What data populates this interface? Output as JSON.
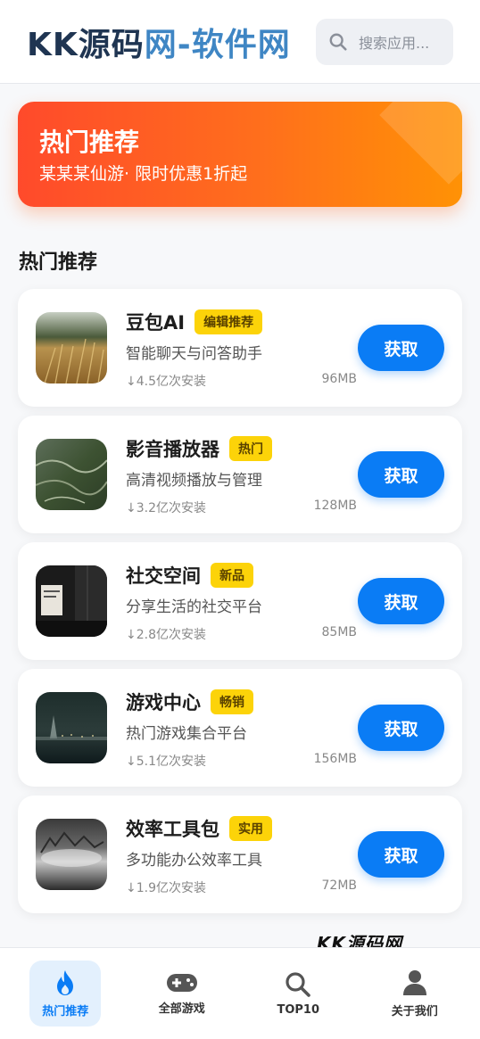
{
  "header": {
    "logo_part1": "KK源码",
    "logo_part2": "网-软件网",
    "search_placeholder": "搜索应用..."
  },
  "banner": {
    "title": "热门推荐",
    "subtitle": "某某某仙游· 限时优惠1折起"
  },
  "section_title": "热门推荐",
  "apps": [
    {
      "name": "豆包AI",
      "tag": "编辑推荐",
      "desc": "智能聊天与问答助手",
      "installs": "↓4.5亿次安装",
      "size": "96MB",
      "button": "获取"
    },
    {
      "name": "影音播放器",
      "tag": "热门",
      "desc": "高清视频播放与管理",
      "installs": "↓3.2亿次安装",
      "size": "128MB",
      "button": "获取"
    },
    {
      "name": "社交空间",
      "tag": "新品",
      "desc": "分享生活的社交平台",
      "installs": "↓2.8亿次安装",
      "size": "85MB",
      "button": "获取"
    },
    {
      "name": "游戏中心",
      "tag": "畅销",
      "desc": "热门游戏集合平台",
      "installs": "↓5.1亿次安装",
      "size": "156MB",
      "button": "获取"
    },
    {
      "name": "效率工具包",
      "tag": "实用",
      "desc": "多功能办公效率工具",
      "installs": "↓1.9亿次安装",
      "size": "72MB",
      "button": "获取"
    }
  ],
  "watermark": "KK源码网",
  "tabbar": [
    {
      "label": "热门推荐",
      "icon": "flame-icon",
      "active": true
    },
    {
      "label": "全部游戏",
      "icon": "gamepad-icon",
      "active": false
    },
    {
      "label": "TOP10",
      "icon": "search-icon",
      "active": false
    },
    {
      "label": "关于我们",
      "icon": "user-icon",
      "active": false
    }
  ],
  "colors": {
    "accent": "#0a7cf5",
    "tag": "#fcd309",
    "banner_start": "#ff4a2b",
    "banner_end": "#ff9205",
    "logo_dark": "#1f3552",
    "logo_blue": "#3f86c4"
  }
}
